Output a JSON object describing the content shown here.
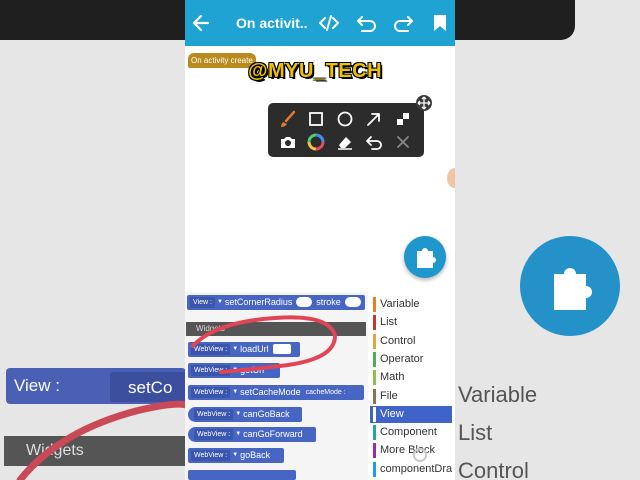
{
  "app": {
    "title": "On activit..."
  },
  "canvas": {
    "event_block": "On activity create",
    "watermark": "@MYU_TECH"
  },
  "icons": {
    "back": "arrow-back-icon",
    "code": "code-icon",
    "undo": "undo-icon",
    "redo": "redo-icon",
    "bookmark": "bookmark-icon",
    "fab": "puzzle-piece-icon",
    "move": "move-icon"
  },
  "draw_tools": [
    "brush",
    "rectangle",
    "circle",
    "arrow",
    "checker",
    "camera",
    "color-wheel",
    "eraser",
    "undo",
    "close"
  ],
  "colors": {
    "app_bar": "#1ea3d2",
    "block": "#4766c4",
    "selected_category": "#3f63c9",
    "event_block": "#b98a1e",
    "watermark": "#f0c000",
    "scribble": "#e04455"
  },
  "palette": {
    "top_block": {
      "dropdown": "View :",
      "label": "setCornerRadius",
      "label2": "stroke"
    },
    "widgets_header": "Widgets",
    "blocks": [
      {
        "dropdown": "WebView :",
        "label": "loadUrl",
        "has_input": true
      },
      {
        "dropdown": "WebView :",
        "label": "getUrl"
      },
      {
        "dropdown": "WebView :",
        "label": "setCacheMode",
        "label2": "cacheMode :"
      },
      {
        "dropdown": "WebView :",
        "label": "canGoBack"
      },
      {
        "dropdown": "WebView :",
        "label": "canGoForward"
      },
      {
        "dropdown": "WebView :",
        "label": "goBack"
      }
    ]
  },
  "categories": [
    {
      "name": "Variable",
      "color": "#e67e22"
    },
    {
      "name": "List",
      "color": "#c0392b"
    },
    {
      "name": "Control",
      "color": "#e1a73b"
    },
    {
      "name": "Operator",
      "color": "#4caf50"
    },
    {
      "name": "Math",
      "color": "#8bc34a"
    },
    {
      "name": "File",
      "color": "#8d6e63"
    },
    {
      "name": "View",
      "color": "#3f63c9",
      "selected": true
    },
    {
      "name": "Component",
      "color": "#26a69a"
    },
    {
      "name": "More Block",
      "color": "#9c27b0"
    },
    {
      "name": "componentDra",
      "color": "#2196f3"
    }
  ],
  "background": {
    "block_label": "View :",
    "block_label2": "setCo",
    "widgets": "Widgets",
    "categories": [
      "Variable",
      "List",
      "Control"
    ]
  }
}
